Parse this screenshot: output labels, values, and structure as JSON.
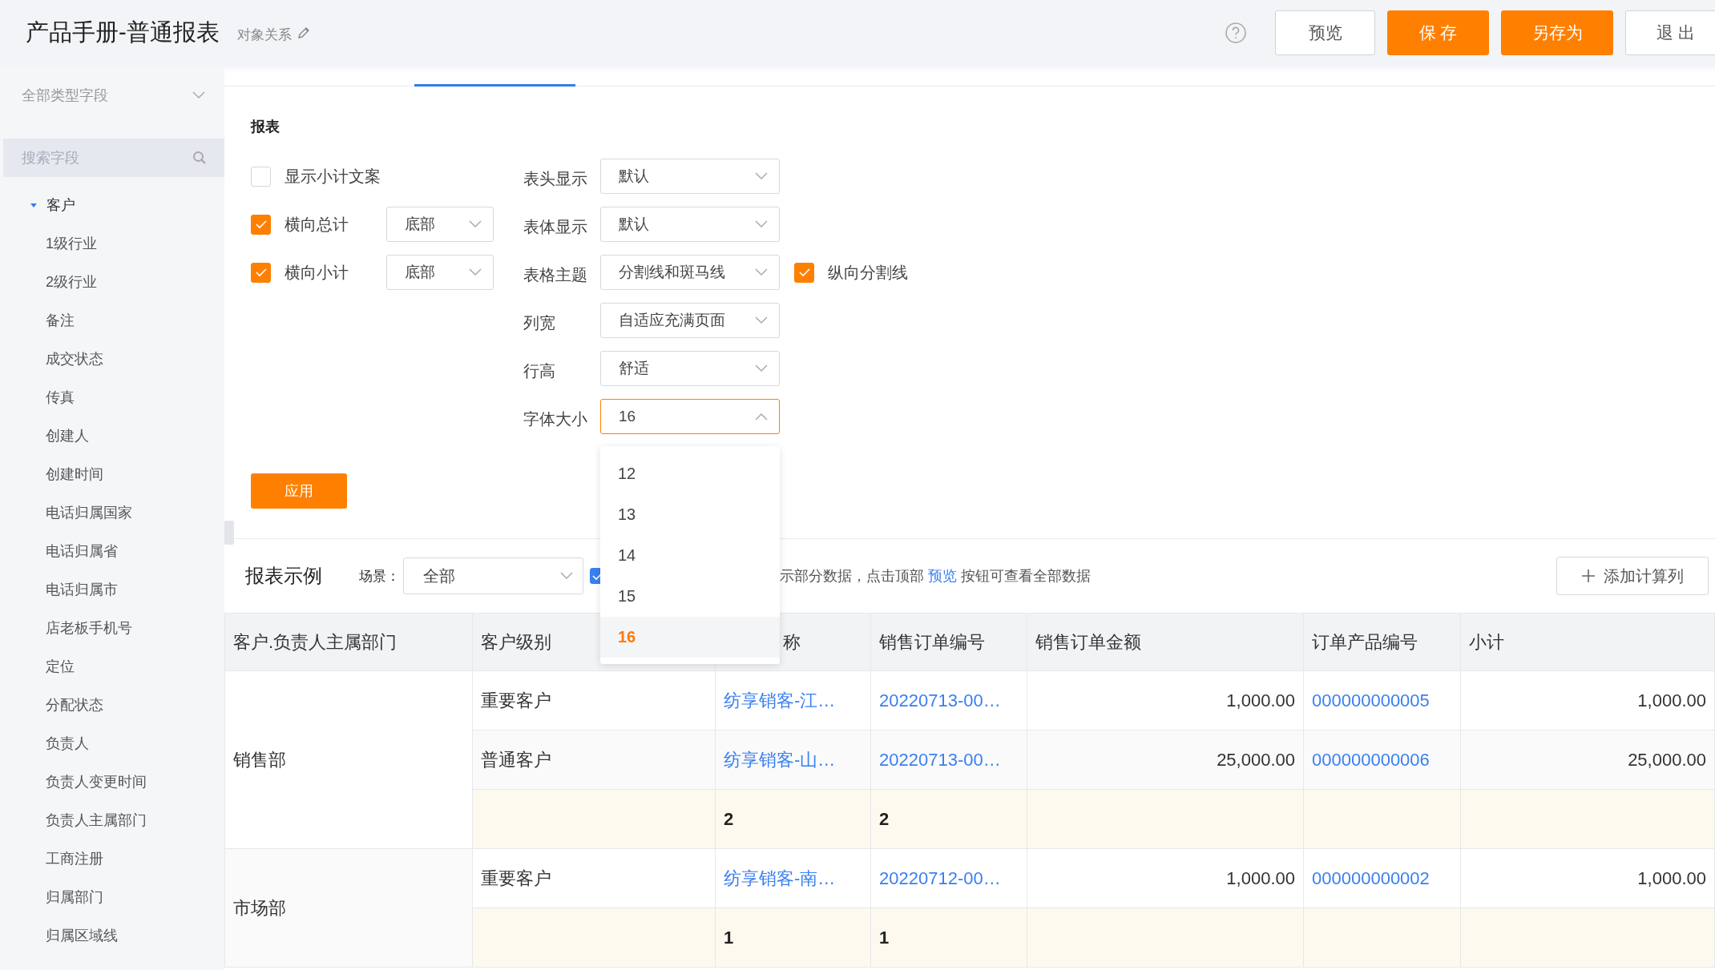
{
  "header": {
    "title": "产品手册-普通报表",
    "subtitle": "对象关系",
    "buttons": [
      {
        "label": "预览",
        "kind": "default"
      },
      {
        "label": "保 存",
        "kind": "primary"
      },
      {
        "label": "另存为",
        "kind": "primary"
      },
      {
        "label": "退 出",
        "kind": "default"
      }
    ]
  },
  "sidebar": {
    "filter": {
      "value": "全部类型字段"
    },
    "search": {
      "placeholder": "搜索字段"
    },
    "tree": [
      {
        "label": "客户",
        "expanded": true,
        "children": [
          {
            "label": "1级行业"
          },
          {
            "label": "2级行业"
          },
          {
            "label": "备注"
          },
          {
            "label": "成交状态"
          },
          {
            "label": "传真"
          },
          {
            "label": "创建人"
          },
          {
            "label": "创建时间"
          },
          {
            "label": "电话归属国家"
          },
          {
            "label": "电话归属省"
          },
          {
            "label": "电话归属市"
          },
          {
            "label": "店老板手机号"
          },
          {
            "label": "定位"
          },
          {
            "label": "分配状态"
          },
          {
            "label": "负责人"
          },
          {
            "label": "负责人变更时间"
          },
          {
            "label": "负责人主属部门"
          },
          {
            "label": "工商注册"
          },
          {
            "label": "归属部门"
          },
          {
            "label": "归属区域线"
          }
        ]
      }
    ]
  },
  "settings": {
    "title": "报表",
    "left_options": [
      {
        "label": "显示小计文案",
        "checked": false
      },
      {
        "label": "横向总计",
        "checked": true,
        "position": "底部"
      },
      {
        "label": "横向小计",
        "checked": true,
        "position": "底部"
      }
    ],
    "right_options": [
      {
        "label": "表头显示",
        "value": "默认",
        "open": false
      },
      {
        "label": "表体显示",
        "value": "默认",
        "open": false
      },
      {
        "label": "表格主题",
        "value": "分割线和斑马线",
        "open": false,
        "extra": {
          "label": "纵向分割线",
          "checked": true
        }
      },
      {
        "label": "列宽",
        "value": "自适应充满页面",
        "open": false
      },
      {
        "label": "行高",
        "value": "舒适",
        "open": false
      },
      {
        "label": "字体大小",
        "value": "16",
        "open": true
      }
    ],
    "font_size_menu": [
      {
        "label": "12",
        "selected": false
      },
      {
        "label": "13",
        "selected": false
      },
      {
        "label": "14",
        "selected": false
      },
      {
        "label": "15",
        "selected": false
      },
      {
        "label": "16",
        "selected": true
      }
    ],
    "apply_button": "应用"
  },
  "sample": {
    "title": "报表示例",
    "scene_label": "场景：",
    "scene_value": "全部",
    "option_checked": true,
    "hint": "示部分数据，点击顶部 ",
    "hint_link": "预览",
    "hint_end": " 按钮可查看全部数据",
    "add_button": "添加计算列"
  },
  "table": {
    "columns": [
      "客户.负责人主属部门",
      "客户级别",
      "称",
      "销售订单编号",
      "销售订单金额",
      "订单产品编号",
      "小计"
    ],
    "groups": [
      {
        "department": "销售部",
        "rows": [
          {
            "kind": "data",
            "cells": [
              "重要客户",
              "纺享销客-江…",
              "20220713-00…",
              "1,000.00",
              "000000000005",
              "1,000.00"
            ]
          },
          {
            "kind": "data",
            "cells": [
              "普通客户",
              "纺享销客-山…",
              "20220713-00…",
              "25,000.00",
              "000000000006",
              "25,000.00"
            ]
          },
          {
            "kind": "subtotal",
            "cells": [
              "",
              "2",
              "2",
              "",
              "",
              ""
            ]
          }
        ]
      },
      {
        "department": "市场部",
        "rows": [
          {
            "kind": "data",
            "cells": [
              "重要客户",
              "纺享销客-南…",
              "20220712-00…",
              "1,000.00",
              "000000000002",
              "1,000.00"
            ]
          },
          {
            "kind": "subtotal",
            "cells": [
              "",
              "1",
              "1",
              "",
              "",
              ""
            ]
          }
        ]
      }
    ]
  }
}
